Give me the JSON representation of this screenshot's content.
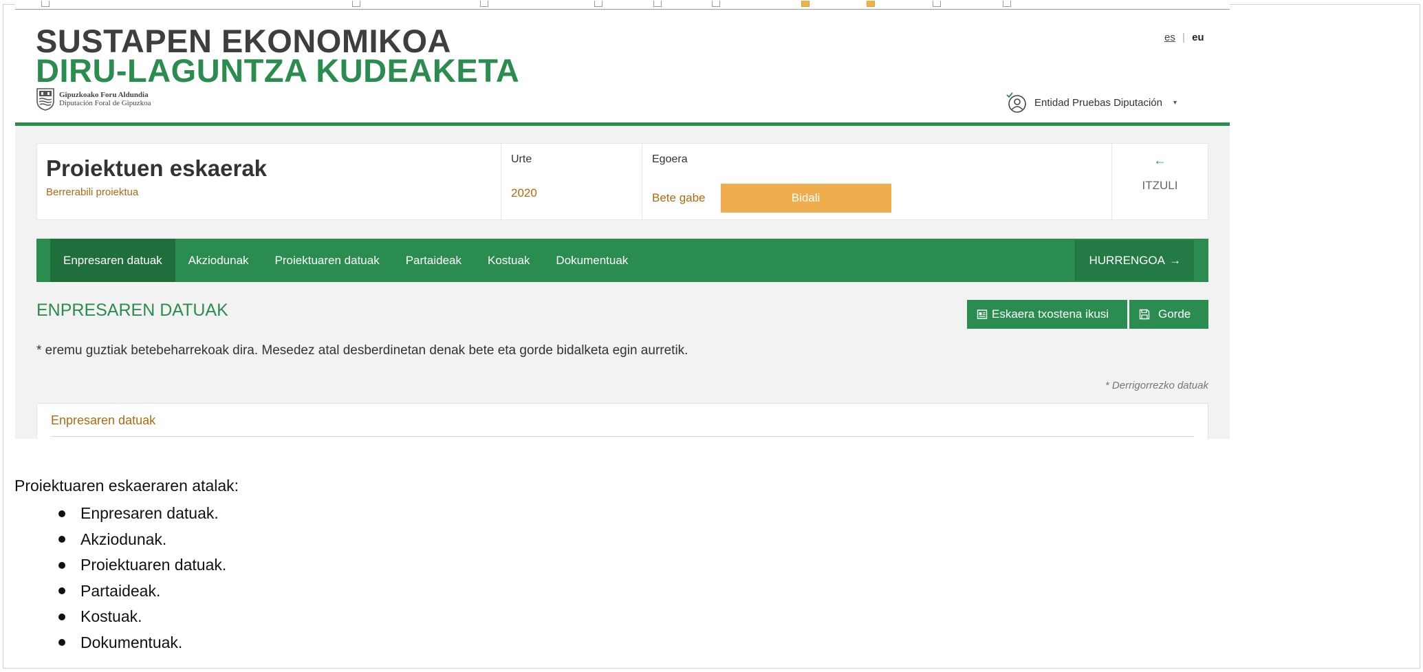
{
  "header": {
    "title_line1": "SUSTAPEN EKONOMIKOA",
    "title_line2": "DIRU-LAGUNTZA KUDEAKETA",
    "gov_line1": "Gipuzkoako Foru Aldundia",
    "gov_line2": "Diputación Foral de Gipuzkoa"
  },
  "lang": {
    "es": "es",
    "separator": "|",
    "eu": "eu"
  },
  "user": {
    "name": "Entidad Pruebas Diputación",
    "caret": "▾"
  },
  "card": {
    "title": "Proiektuen eskaerak",
    "reuse_link": "Berrerabili proiektua",
    "year_label": "Urte",
    "year_value": "2020",
    "state_label": "Egoera",
    "state_value": "Bete gabe",
    "send_button": "Bidali",
    "back_arrow": "←",
    "back_label": "ITZULI"
  },
  "nav": {
    "tabs": [
      {
        "label": "Enpresaren datuak"
      },
      {
        "label": "Akziodunak"
      },
      {
        "label": "Proiektuaren datuak"
      },
      {
        "label": "Partaideak"
      },
      {
        "label": "Kostuak"
      },
      {
        "label": "Dokumentuak"
      }
    ],
    "next_label": "HURRENGOA",
    "next_arrow": "→"
  },
  "section": {
    "title": "ENPRESAREN DATUAK",
    "report_button": "Eskaera txostena ikusi",
    "save_button": "Gorde",
    "note": "* eremu guztiak betebeharrekoak dira. Mesedez atal desberdinetan denak bete eta gorde bidalketa egin aurretik.",
    "required_hint": "* Derrigorrezko datuak",
    "panel_title": "Enpresaren datuak"
  },
  "doc": {
    "intro": "Proiektuaren eskaeraren atalak:",
    "items": [
      "Enpresaren datuak.",
      "Akziodunak.",
      "Proiektuaren datuak.",
      "Partaideak.",
      "Kostuak.",
      "Dokumentuak."
    ]
  },
  "colors": {
    "brand_green": "#2a8c4e",
    "active_tab": "#1f6e3c",
    "accent_orange": "#f0ad4e",
    "link_brown": "#b06a10",
    "title_grey": "#3e3e3e"
  },
  "icons": {
    "crest": "coat-of-arms-icon",
    "user": "user-check-icon",
    "report": "document-icon",
    "save": "floppy-disk-icon"
  }
}
